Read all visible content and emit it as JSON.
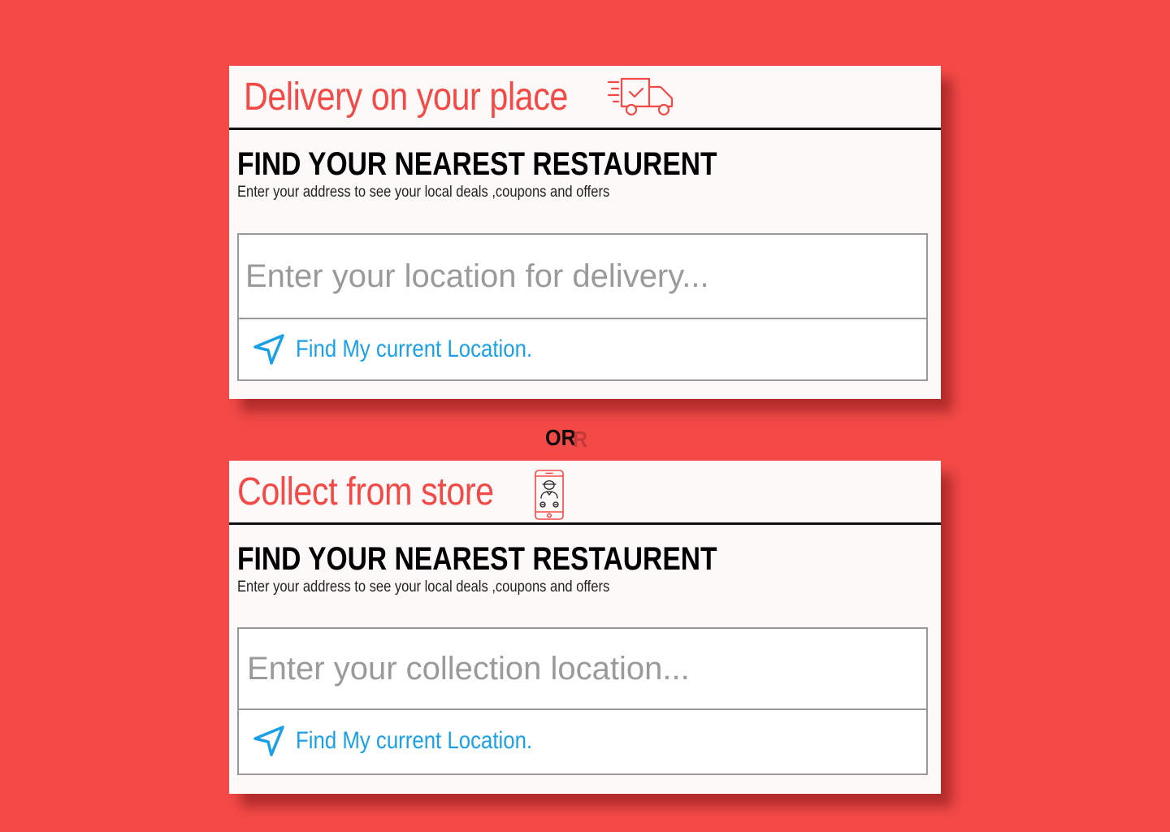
{
  "delivery": {
    "title": "Delivery on your place",
    "icon": "delivery-truck-icon",
    "heading": "FIND YOUR NEAREST RESTAURENT",
    "subtext": "Enter your address to see your local deals ,coupons and offers",
    "input_placeholder": "Enter your location for delivery...",
    "find_location_label": "Find My current Location."
  },
  "separator": {
    "label": "OR",
    "shadow_label": "R"
  },
  "collect": {
    "title": "Collect from store",
    "icon": "phone-contact-icon",
    "heading": "FIND YOUR NEAREST RESTAURENT",
    "subtext": "Enter your address to see your local deals ,coupons and offers",
    "input_placeholder": "Enter your collection location...",
    "find_location_label": "Find My current Location."
  },
  "colors": {
    "background": "#f44a47",
    "card": "#fdf9f8",
    "accent": "#f44a47",
    "link": "#1aa0e6"
  }
}
